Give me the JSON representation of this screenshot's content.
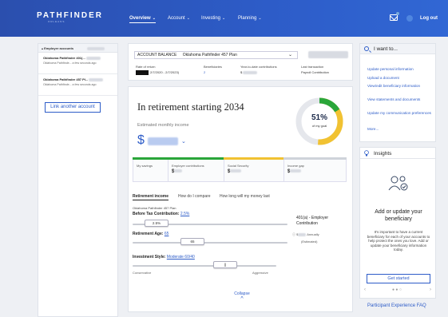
{
  "header": {
    "logo": "PATHFINDER",
    "logo_sub": "ORLEANS",
    "nav": [
      {
        "label": "Overview"
      },
      {
        "label": "Account"
      },
      {
        "label": "Investing"
      },
      {
        "label": "Planning"
      }
    ],
    "logout": "Log out",
    "nav_chevron": "⌄"
  },
  "sidebar": {
    "section_label": "Employer accounts",
    "items": [
      {
        "title": "Oklahoma Pathfinder 401(...",
        "subtitle": "Oklahoma Pathfinde...  a few seconds ago"
      },
      {
        "title": "Oklahoma Pathfinder 457 Pl...",
        "subtitle": "Oklahoma Pathfinde...  a few seconds ago"
      }
    ],
    "link_button": "Link another account"
  },
  "account": {
    "label": "ACCOUNT BALANCE",
    "plan": "Oklahoma Pathfinder 457 Plan",
    "rate_label": "Rate of return",
    "rate_value": "2/7/2020 - 2/7/2023)",
    "beneficiaries_label": "Beneficiaries",
    "beneficiaries_value": "2",
    "ytd_label": "Year-to-date contributions",
    "ytd_value": "$",
    "last_tx_label": "Last transaction",
    "last_tx_value": "Payroll Contribution"
  },
  "retirement": {
    "title": "In retirement starting 2034",
    "subtitle": "Estimated monthly income",
    "dollar_sign": "$",
    "goal_percent": "51%",
    "goal_label": "of my goal",
    "goal_fraction": 0.51,
    "segments": [
      {
        "label": "My savings",
        "value": "",
        "color": "#ffffff"
      },
      {
        "label": "Employer contributions",
        "value": "$",
        "color": "#2aa63a"
      },
      {
        "label": "Social Security",
        "value": "$",
        "color": "#f1c232"
      },
      {
        "label": "Income gap",
        "value": "$",
        "color": "#cfd3da"
      }
    ],
    "tabs": [
      "Retirement income",
      "How do I compare",
      "How long will my money last"
    ],
    "plan_name": "Oklahoma Pathfinder 457 Plan",
    "contribution_label": "Before Tax Contribution:",
    "contribution_value": "2.5%",
    "contribution_thumb": "2.5%",
    "match_label": "401(a) - Employer Contribution",
    "retirement_age_label": "Retirement Age:",
    "retirement_age_value": "65",
    "retirement_age_thumb": "65",
    "annual_prefix": "$",
    "annual_label": "Annually",
    "estimated_label": "(Estimated)",
    "investment_label": "Investment Style:",
    "investment_value": "Moderate 60/40",
    "investment_thumb": "||",
    "conservative": "Conservative",
    "aggressive": "Aggressive",
    "collapse": "Collapse",
    "collapse_icon": "^"
  },
  "want": {
    "title": "I want to...",
    "links": [
      "Update personal information",
      "Upload a document",
      "View/edit beneficiary information",
      "View statements and documents",
      "Update my communication preferences",
      "More..."
    ]
  },
  "insights": {
    "title": "Insights",
    "heading": "Add or update your beneficiary",
    "body": "It's important to have a current beneficiary for each of your accounts to help protect the ones you love. Add or update your beneficiary information today.",
    "button": "Get started",
    "prev": "‹",
    "next": "›",
    "dots": "● ● ○"
  },
  "footer_link": "Participant Experience FAQ"
}
